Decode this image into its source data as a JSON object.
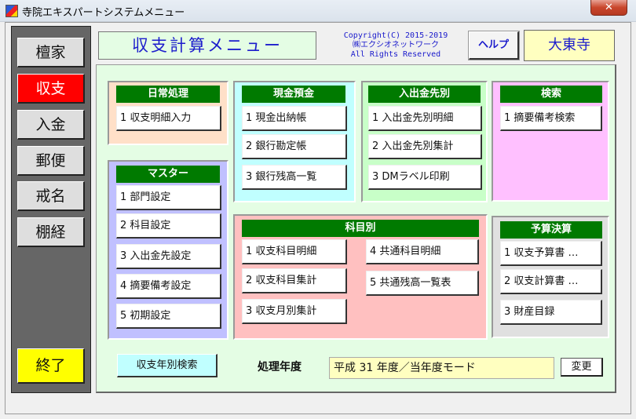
{
  "window": {
    "title": "寺院エキスパートシステムメニュー",
    "close_label": "x"
  },
  "sidebar": {
    "items": [
      {
        "label": "檀家",
        "active": false
      },
      {
        "label": "収支",
        "active": true
      },
      {
        "label": "入金",
        "active": false
      },
      {
        "label": "郵便",
        "active": false
      },
      {
        "label": "戒名",
        "active": false
      },
      {
        "label": "棚経",
        "active": false
      }
    ],
    "exit_label": "終了"
  },
  "header": {
    "menu_title": "収支計算メニュー",
    "copyright_lines": [
      "Copyright(C) 2015-2019",
      "㈱エクシオネットワーク",
      "All Rights Reserved"
    ],
    "help_label": "ヘルプ",
    "temple_name": "大東寺"
  },
  "panels": {
    "daily": {
      "title": "日常処理",
      "buttons": [
        "1 収支明細入力"
      ]
    },
    "master": {
      "title": "マスター",
      "buttons": [
        "1 部門設定",
        "2 科目設定",
        "3 入出金先設定",
        "4 摘要備考設定",
        "5 初期設定"
      ]
    },
    "cash": {
      "title": "現金預金",
      "buttons": [
        "1 現金出納帳",
        "2 銀行勘定帳",
        "3 銀行残高一覧"
      ]
    },
    "partner": {
      "title": "入出金先別",
      "buttons": [
        "1 入出金先別明細",
        "2 入出金先別集計",
        "3 DMラベル印刷"
      ]
    },
    "search": {
      "title": "検索",
      "buttons": [
        "1 摘要備考検索"
      ]
    },
    "account": {
      "title": "科目別",
      "buttons": [
        "1 収支科目明細",
        "2 収支科目集計",
        "3 収支月別集計",
        "4 共通科目明細",
        "5 共通残高一覧表"
      ]
    },
    "budget": {
      "title": "予算決算",
      "buttons": [
        "1 収支予算書 …",
        "2 収支計算書 …",
        "3 財産目録"
      ]
    }
  },
  "footer": {
    "yearly_search_label": "収支年別検索",
    "year_label": "処理年度",
    "year_value": "平成 31  年度／当年度モード",
    "change_label": "変更"
  },
  "colors": {
    "panel_header": "#007a00",
    "active_nav": "#ff0000",
    "exit": "#ffff00",
    "daily_bg": "#ffe0c8",
    "master_bg": "#c0c0ff",
    "cash_bg": "#c0ffff",
    "partner_bg": "#c8ffc8",
    "search_bg": "#ffc0ff",
    "account_bg": "#ffc0c0",
    "budget_bg": "#e0e0e0"
  }
}
